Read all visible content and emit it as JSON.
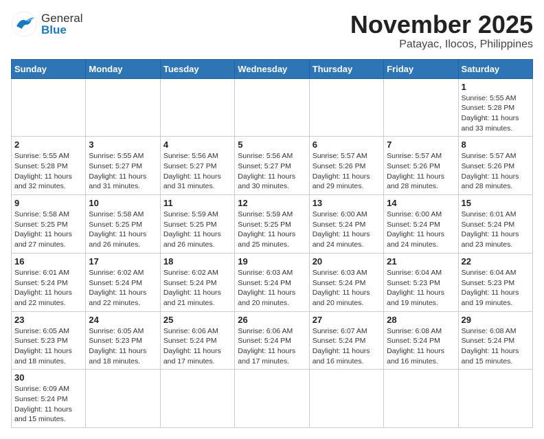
{
  "header": {
    "logo_general": "General",
    "logo_blue": "Blue",
    "month_title": "November 2025",
    "location": "Patayac, Ilocos, Philippines"
  },
  "weekdays": [
    "Sunday",
    "Monday",
    "Tuesday",
    "Wednesday",
    "Thursday",
    "Friday",
    "Saturday"
  ],
  "weeks": [
    [
      {
        "day": null,
        "info": null
      },
      {
        "day": null,
        "info": null
      },
      {
        "day": null,
        "info": null
      },
      {
        "day": null,
        "info": null
      },
      {
        "day": null,
        "info": null
      },
      {
        "day": null,
        "info": null
      },
      {
        "day": "1",
        "info": "Sunrise: 5:55 AM\nSunset: 5:28 PM\nDaylight: 11 hours\nand 33 minutes."
      }
    ],
    [
      {
        "day": "2",
        "info": "Sunrise: 5:55 AM\nSunset: 5:28 PM\nDaylight: 11 hours\nand 32 minutes."
      },
      {
        "day": "3",
        "info": "Sunrise: 5:55 AM\nSunset: 5:27 PM\nDaylight: 11 hours\nand 31 minutes."
      },
      {
        "day": "4",
        "info": "Sunrise: 5:56 AM\nSunset: 5:27 PM\nDaylight: 11 hours\nand 31 minutes."
      },
      {
        "day": "5",
        "info": "Sunrise: 5:56 AM\nSunset: 5:27 PM\nDaylight: 11 hours\nand 30 minutes."
      },
      {
        "day": "6",
        "info": "Sunrise: 5:57 AM\nSunset: 5:26 PM\nDaylight: 11 hours\nand 29 minutes."
      },
      {
        "day": "7",
        "info": "Sunrise: 5:57 AM\nSunset: 5:26 PM\nDaylight: 11 hours\nand 28 minutes."
      },
      {
        "day": "8",
        "info": "Sunrise: 5:57 AM\nSunset: 5:26 PM\nDaylight: 11 hours\nand 28 minutes."
      }
    ],
    [
      {
        "day": "9",
        "info": "Sunrise: 5:58 AM\nSunset: 5:25 PM\nDaylight: 11 hours\nand 27 minutes."
      },
      {
        "day": "10",
        "info": "Sunrise: 5:58 AM\nSunset: 5:25 PM\nDaylight: 11 hours\nand 26 minutes."
      },
      {
        "day": "11",
        "info": "Sunrise: 5:59 AM\nSunset: 5:25 PM\nDaylight: 11 hours\nand 26 minutes."
      },
      {
        "day": "12",
        "info": "Sunrise: 5:59 AM\nSunset: 5:25 PM\nDaylight: 11 hours\nand 25 minutes."
      },
      {
        "day": "13",
        "info": "Sunrise: 6:00 AM\nSunset: 5:24 PM\nDaylight: 11 hours\nand 24 minutes."
      },
      {
        "day": "14",
        "info": "Sunrise: 6:00 AM\nSunset: 5:24 PM\nDaylight: 11 hours\nand 24 minutes."
      },
      {
        "day": "15",
        "info": "Sunrise: 6:01 AM\nSunset: 5:24 PM\nDaylight: 11 hours\nand 23 minutes."
      }
    ],
    [
      {
        "day": "16",
        "info": "Sunrise: 6:01 AM\nSunset: 5:24 PM\nDaylight: 11 hours\nand 22 minutes."
      },
      {
        "day": "17",
        "info": "Sunrise: 6:02 AM\nSunset: 5:24 PM\nDaylight: 11 hours\nand 22 minutes."
      },
      {
        "day": "18",
        "info": "Sunrise: 6:02 AM\nSunset: 5:24 PM\nDaylight: 11 hours\nand 21 minutes."
      },
      {
        "day": "19",
        "info": "Sunrise: 6:03 AM\nSunset: 5:24 PM\nDaylight: 11 hours\nand 20 minutes."
      },
      {
        "day": "20",
        "info": "Sunrise: 6:03 AM\nSunset: 5:24 PM\nDaylight: 11 hours\nand 20 minutes."
      },
      {
        "day": "21",
        "info": "Sunrise: 6:04 AM\nSunset: 5:23 PM\nDaylight: 11 hours\nand 19 minutes."
      },
      {
        "day": "22",
        "info": "Sunrise: 6:04 AM\nSunset: 5:23 PM\nDaylight: 11 hours\nand 19 minutes."
      }
    ],
    [
      {
        "day": "23",
        "info": "Sunrise: 6:05 AM\nSunset: 5:23 PM\nDaylight: 11 hours\nand 18 minutes."
      },
      {
        "day": "24",
        "info": "Sunrise: 6:05 AM\nSunset: 5:23 PM\nDaylight: 11 hours\nand 18 minutes."
      },
      {
        "day": "25",
        "info": "Sunrise: 6:06 AM\nSunset: 5:24 PM\nDaylight: 11 hours\nand 17 minutes."
      },
      {
        "day": "26",
        "info": "Sunrise: 6:06 AM\nSunset: 5:24 PM\nDaylight: 11 hours\nand 17 minutes."
      },
      {
        "day": "27",
        "info": "Sunrise: 6:07 AM\nSunset: 5:24 PM\nDaylight: 11 hours\nand 16 minutes."
      },
      {
        "day": "28",
        "info": "Sunrise: 6:08 AM\nSunset: 5:24 PM\nDaylight: 11 hours\nand 16 minutes."
      },
      {
        "day": "29",
        "info": "Sunrise: 6:08 AM\nSunset: 5:24 PM\nDaylight: 11 hours\nand 15 minutes."
      }
    ],
    [
      {
        "day": "30",
        "info": "Sunrise: 6:09 AM\nSunset: 5:24 PM\nDaylight: 11 hours\nand 15 minutes."
      },
      {
        "day": null,
        "info": null
      },
      {
        "day": null,
        "info": null
      },
      {
        "day": null,
        "info": null
      },
      {
        "day": null,
        "info": null
      },
      {
        "day": null,
        "info": null
      },
      {
        "day": null,
        "info": null
      }
    ]
  ]
}
